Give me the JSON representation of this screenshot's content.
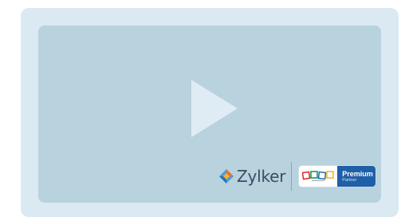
{
  "video": {
    "play_icon": "play-icon"
  },
  "branding": {
    "logo_icon": "zylker-logo-icon",
    "company_name": "Zylker",
    "badge": {
      "zoho_logo_icon": "zoho-logo-icon",
      "tier": "Premium",
      "type": "Partner"
    }
  },
  "colors": {
    "outer_card": "#dbe9f2",
    "video_frame": "#b8d2de",
    "play_icon": "#dfecf3",
    "badge_accent": "#1f5fa8",
    "zylker_text": "#3b4d63"
  }
}
